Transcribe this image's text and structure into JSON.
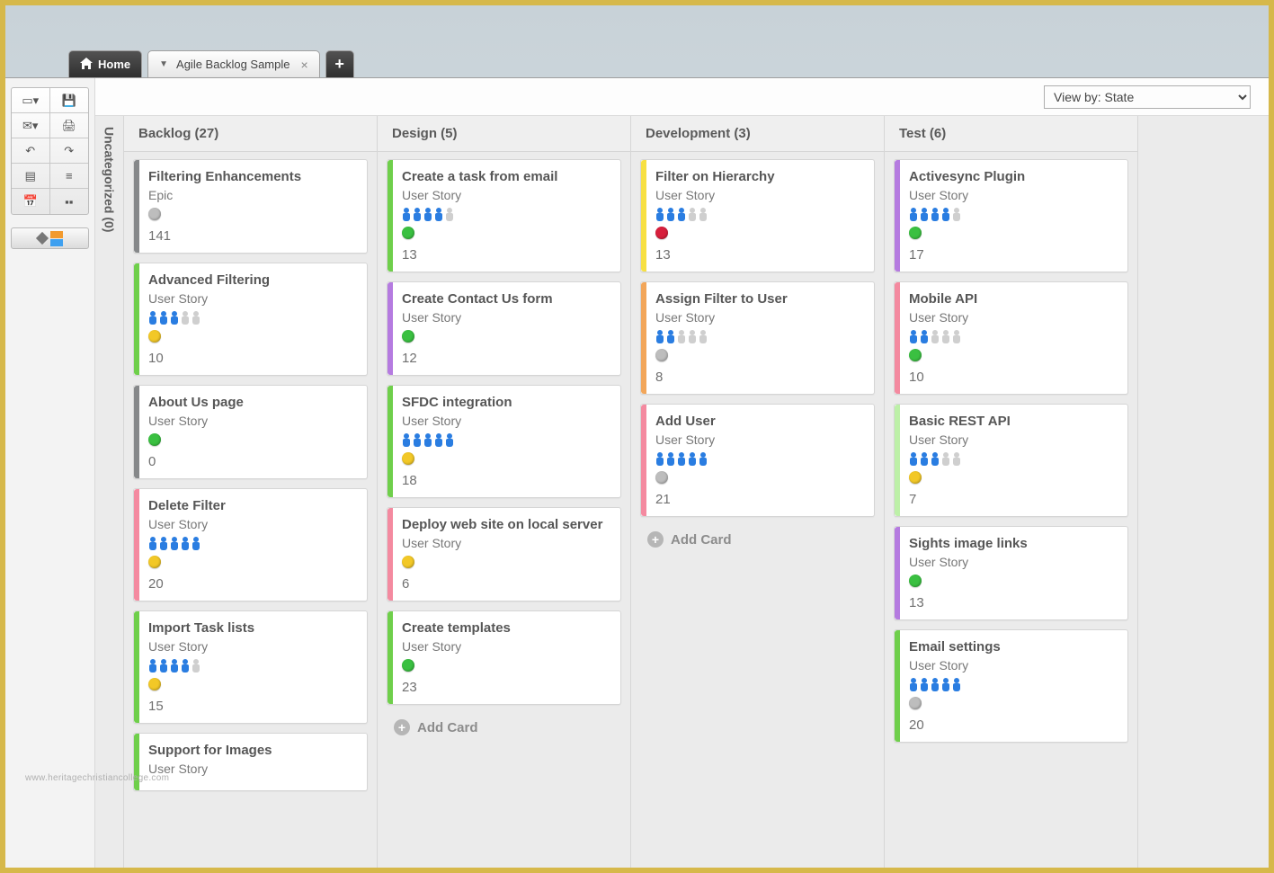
{
  "tabs": {
    "home": "Home",
    "doc": "Agile Backlog Sample"
  },
  "viewby": "View by: State",
  "uncategorized": {
    "label": "Uncategorized",
    "count": 0
  },
  "addcard": "Add Card",
  "watermark": "www.heritagechristiancollege.com",
  "columns": [
    {
      "title": "Backlog",
      "count": 27,
      "cards": [
        {
          "title": "Filtering Enhancements",
          "type": "Epic",
          "stripe": "c-gray",
          "people": null,
          "dot": "d-gray",
          "points": 141
        },
        {
          "title": "Advanced Filtering",
          "type": "User Story",
          "stripe": "c-green",
          "people": [
            1,
            1,
            1,
            0,
            0
          ],
          "dot": "d-yellow",
          "points": 10
        },
        {
          "title": "About Us page",
          "type": "User Story",
          "stripe": "c-gray",
          "people": null,
          "dot": "d-green",
          "points": 0
        },
        {
          "title": "Delete Filter",
          "type": "User Story",
          "stripe": "c-pink",
          "people": [
            1,
            1,
            1,
            1,
            1
          ],
          "dot": "d-yellow",
          "points": 20
        },
        {
          "title": "Import Task lists",
          "type": "User Story",
          "stripe": "c-green",
          "people": [
            1,
            1,
            1,
            1,
            0
          ],
          "dot": "d-yellow",
          "points": 15
        },
        {
          "title": "Support for Images",
          "type": "User Story",
          "stripe": "c-green",
          "people": null,
          "dot": null,
          "points": null
        }
      ],
      "showAdd": false
    },
    {
      "title": "Design",
      "count": 5,
      "cards": [
        {
          "title": "Create a task from email",
          "type": "User Story",
          "stripe": "c-green",
          "people": [
            1,
            1,
            1,
            1,
            0
          ],
          "dot": "d-green",
          "points": 13
        },
        {
          "title": "Create Contact Us form",
          "type": "User Story",
          "stripe": "c-purple",
          "people": null,
          "dot": "d-green",
          "points": 12
        },
        {
          "title": "SFDC integration",
          "type": "User Story",
          "stripe": "c-green",
          "people": [
            1,
            1,
            1,
            1,
            1
          ],
          "dot": "d-yellow",
          "points": 18
        },
        {
          "title": "Deploy web site on local server",
          "type": "User Story",
          "stripe": "c-pink",
          "people": null,
          "dot": "d-yellow",
          "points": 6
        },
        {
          "title": "Create templates",
          "type": "User Story",
          "stripe": "c-green",
          "people": null,
          "dot": "d-green",
          "points": 23
        }
      ],
      "showAdd": true
    },
    {
      "title": "Development",
      "count": 3,
      "cards": [
        {
          "title": "Filter on Hierarchy",
          "type": "User Story",
          "stripe": "c-yellow",
          "people": [
            1,
            1,
            1,
            0,
            0
          ],
          "dot": "d-red",
          "points": 13
        },
        {
          "title": "Assign Filter to User",
          "type": "User Story",
          "stripe": "c-orange",
          "people": [
            1,
            1,
            0,
            0,
            0
          ],
          "dot": "d-gray",
          "points": 8
        },
        {
          "title": "Add User",
          "type": "User Story",
          "stripe": "c-pink",
          "people": [
            1,
            1,
            1,
            1,
            1
          ],
          "dot": "d-gray",
          "points": 21
        }
      ],
      "showAdd": true
    },
    {
      "title": "Test",
      "count": 6,
      "cards": [
        {
          "title": "Activesync Plugin",
          "type": "User Story",
          "stripe": "c-purple",
          "people": [
            1,
            1,
            1,
            1,
            0
          ],
          "dot": "d-green",
          "points": 17
        },
        {
          "title": "Mobile API",
          "type": "User Story",
          "stripe": "c-pink",
          "people": [
            1,
            1,
            0,
            0,
            0
          ],
          "dot": "d-green",
          "points": 10
        },
        {
          "title": "Basic REST API",
          "type": "User Story",
          "stripe": "c-lgreen",
          "people": [
            1,
            1,
            1,
            0,
            0
          ],
          "dot": "d-yellow",
          "points": 7
        },
        {
          "title": "Sights image links",
          "type": "User Story",
          "stripe": "c-purple",
          "people": null,
          "dot": "d-green",
          "points": 13
        },
        {
          "title": "Email settings",
          "type": "User Story",
          "stripe": "c-green",
          "people": [
            1,
            1,
            1,
            1,
            1
          ],
          "dot": "d-gray",
          "points": 20
        }
      ],
      "showAdd": false
    }
  ]
}
